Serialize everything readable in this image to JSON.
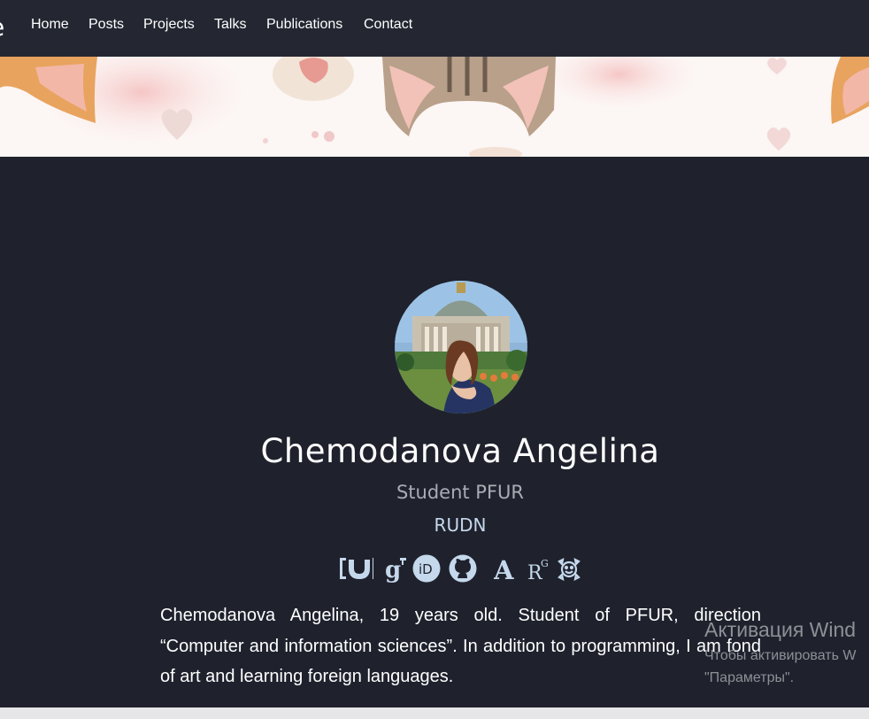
{
  "navbar": {
    "items": [
      {
        "label": "Home"
      },
      {
        "label": "Posts"
      },
      {
        "label": "Projects"
      },
      {
        "label": "Talks"
      },
      {
        "label": "Publications"
      },
      {
        "label": "Contact"
      }
    ]
  },
  "profile": {
    "name": "Chemodanova Angelina",
    "role": "Student PFUR",
    "organization": "RUDN",
    "bio": "Chemodanova Angelina, 19 years old. Student of PFUR, direction “Computer and information sciences”. In addition to programming, I am fond of art and learning foreign languages.",
    "social_icons": [
      "cv-icon",
      "google-scholar-icon",
      "orcid-icon",
      "github-icon",
      "academia-icon",
      "researchgate-icon",
      "gravatar-icon"
    ]
  },
  "watermark": {
    "title": "Активация Wind",
    "line1": "Чтобы активировать W",
    "line2": "\"Параметры\"."
  },
  "colors": {
    "background": "#1f222d",
    "navbar": "#242732",
    "link_accent": "#c5d8ec",
    "muted_text": "#a9acb3"
  }
}
